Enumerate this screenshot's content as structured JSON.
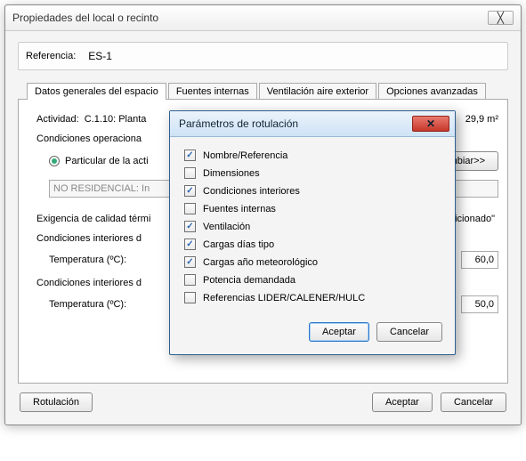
{
  "window": {
    "title": "Propiedades del local o recinto",
    "close_glyph": "╳"
  },
  "reference": {
    "label": "Referencia:",
    "value": "ES-1"
  },
  "tabs": [
    {
      "label": "Datos generales del espacio"
    },
    {
      "label": "Fuentes internas"
    },
    {
      "label": "Ventilación aire exterior"
    },
    {
      "label": "Opciones avanzadas"
    }
  ],
  "general": {
    "activity_label": "Actividad:",
    "activity_value": "C.1.10: Planta",
    "area_value": "29,9 m²",
    "cond_oper_label": "Condiciones operaciona",
    "radio_particular": "Particular de la acti",
    "disabled_text": "NO RESIDENCIAL: In",
    "change_button": "mbiar>>",
    "exigencia_label": "Exigencia de calidad térmi",
    "exigencia_tail": "idicionado\"",
    "cond_int_label": "Condiciones interiores d",
    "temp_label": "Temperatura (ºC):",
    "temp_value_1": "60,0",
    "cond_int_label_2": "Condiciones interiores d",
    "temp_label_2": "Temperatura (ºC):",
    "temp_value_2": "50,0"
  },
  "bottom": {
    "rotulacion": "Rotulación",
    "accept": "Aceptar",
    "cancel": "Cancelar"
  },
  "modal": {
    "title": "Parámetros de rotulación",
    "close_glyph": "✕",
    "options": [
      {
        "label": "Nombre/Referencia",
        "checked": true
      },
      {
        "label": "Dimensiones",
        "checked": false
      },
      {
        "label": "Condiciones interiores",
        "checked": true
      },
      {
        "label": "Fuentes internas",
        "checked": false
      },
      {
        "label": "Ventilación",
        "checked": true
      },
      {
        "label": "Cargas días tipo",
        "checked": true
      },
      {
        "label": "Cargas año meteorológico",
        "checked": true
      },
      {
        "label": "Potencia demandada",
        "checked": false
      },
      {
        "label": "Referencias LIDER/CALENER/HULC",
        "checked": false
      }
    ],
    "accept": "Aceptar",
    "cancel": "Cancelar"
  }
}
